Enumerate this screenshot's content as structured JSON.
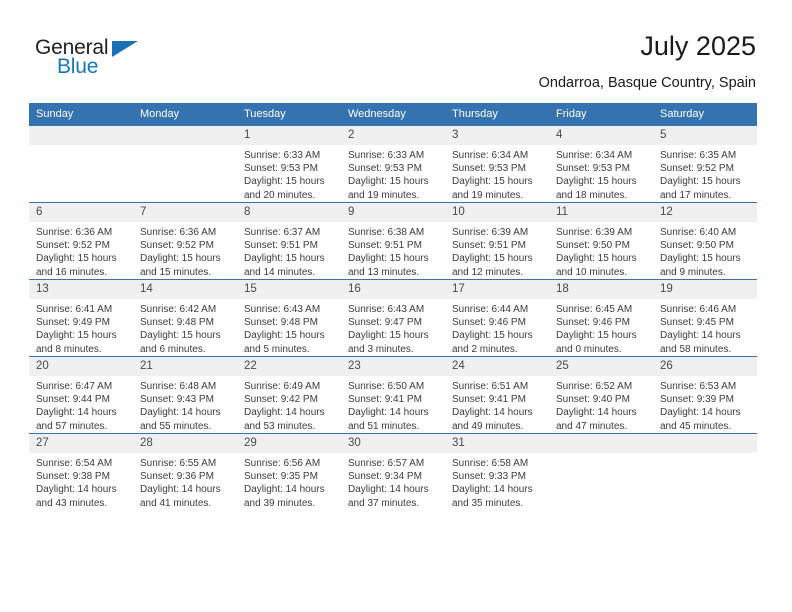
{
  "brand": {
    "name_top": "General",
    "name_bottom": "Blue",
    "accent_color": "#1b75bb",
    "header_color": "#3572b0"
  },
  "header": {
    "title": "July 2025",
    "subtitle": "Ondarroa, Basque Country, Spain"
  },
  "weekday_headers": [
    "Sunday",
    "Monday",
    "Tuesday",
    "Wednesday",
    "Thursday",
    "Friday",
    "Saturday"
  ],
  "labels": {
    "sunrise_prefix": "Sunrise:",
    "sunset_prefix": "Sunset:",
    "daylight_prefix": "Daylight:"
  },
  "weeks": [
    [
      {
        "day": "",
        "empty": true
      },
      {
        "day": "",
        "empty": true
      },
      {
        "day": "1",
        "sunrise": "Sunrise: 6:33 AM",
        "sunset": "Sunset: 9:53 PM",
        "daylight1": "Daylight: 15 hours",
        "daylight2": "and 20 minutes."
      },
      {
        "day": "2",
        "sunrise": "Sunrise: 6:33 AM",
        "sunset": "Sunset: 9:53 PM",
        "daylight1": "Daylight: 15 hours",
        "daylight2": "and 19 minutes."
      },
      {
        "day": "3",
        "sunrise": "Sunrise: 6:34 AM",
        "sunset": "Sunset: 9:53 PM",
        "daylight1": "Daylight: 15 hours",
        "daylight2": "and 19 minutes."
      },
      {
        "day": "4",
        "sunrise": "Sunrise: 6:34 AM",
        "sunset": "Sunset: 9:53 PM",
        "daylight1": "Daylight: 15 hours",
        "daylight2": "and 18 minutes."
      },
      {
        "day": "5",
        "sunrise": "Sunrise: 6:35 AM",
        "sunset": "Sunset: 9:52 PM",
        "daylight1": "Daylight: 15 hours",
        "daylight2": "and 17 minutes."
      }
    ],
    [
      {
        "day": "6",
        "sunrise": "Sunrise: 6:36 AM",
        "sunset": "Sunset: 9:52 PM",
        "daylight1": "Daylight: 15 hours",
        "daylight2": "and 16 minutes."
      },
      {
        "day": "7",
        "sunrise": "Sunrise: 6:36 AM",
        "sunset": "Sunset: 9:52 PM",
        "daylight1": "Daylight: 15 hours",
        "daylight2": "and 15 minutes."
      },
      {
        "day": "8",
        "sunrise": "Sunrise: 6:37 AM",
        "sunset": "Sunset: 9:51 PM",
        "daylight1": "Daylight: 15 hours",
        "daylight2": "and 14 minutes."
      },
      {
        "day": "9",
        "sunrise": "Sunrise: 6:38 AM",
        "sunset": "Sunset: 9:51 PM",
        "daylight1": "Daylight: 15 hours",
        "daylight2": "and 13 minutes."
      },
      {
        "day": "10",
        "sunrise": "Sunrise: 6:39 AM",
        "sunset": "Sunset: 9:51 PM",
        "daylight1": "Daylight: 15 hours",
        "daylight2": "and 12 minutes."
      },
      {
        "day": "11",
        "sunrise": "Sunrise: 6:39 AM",
        "sunset": "Sunset: 9:50 PM",
        "daylight1": "Daylight: 15 hours",
        "daylight2": "and 10 minutes."
      },
      {
        "day": "12",
        "sunrise": "Sunrise: 6:40 AM",
        "sunset": "Sunset: 9:50 PM",
        "daylight1": "Daylight: 15 hours",
        "daylight2": "and 9 minutes."
      }
    ],
    [
      {
        "day": "13",
        "sunrise": "Sunrise: 6:41 AM",
        "sunset": "Sunset: 9:49 PM",
        "daylight1": "Daylight: 15 hours",
        "daylight2": "and 8 minutes."
      },
      {
        "day": "14",
        "sunrise": "Sunrise: 6:42 AM",
        "sunset": "Sunset: 9:48 PM",
        "daylight1": "Daylight: 15 hours",
        "daylight2": "and 6 minutes."
      },
      {
        "day": "15",
        "sunrise": "Sunrise: 6:43 AM",
        "sunset": "Sunset: 9:48 PM",
        "daylight1": "Daylight: 15 hours",
        "daylight2": "and 5 minutes."
      },
      {
        "day": "16",
        "sunrise": "Sunrise: 6:43 AM",
        "sunset": "Sunset: 9:47 PM",
        "daylight1": "Daylight: 15 hours",
        "daylight2": "and 3 minutes."
      },
      {
        "day": "17",
        "sunrise": "Sunrise: 6:44 AM",
        "sunset": "Sunset: 9:46 PM",
        "daylight1": "Daylight: 15 hours",
        "daylight2": "and 2 minutes."
      },
      {
        "day": "18",
        "sunrise": "Sunrise: 6:45 AM",
        "sunset": "Sunset: 9:46 PM",
        "daylight1": "Daylight: 15 hours",
        "daylight2": "and 0 minutes."
      },
      {
        "day": "19",
        "sunrise": "Sunrise: 6:46 AM",
        "sunset": "Sunset: 9:45 PM",
        "daylight1": "Daylight: 14 hours",
        "daylight2": "and 58 minutes."
      }
    ],
    [
      {
        "day": "20",
        "sunrise": "Sunrise: 6:47 AM",
        "sunset": "Sunset: 9:44 PM",
        "daylight1": "Daylight: 14 hours",
        "daylight2": "and 57 minutes."
      },
      {
        "day": "21",
        "sunrise": "Sunrise: 6:48 AM",
        "sunset": "Sunset: 9:43 PM",
        "daylight1": "Daylight: 14 hours",
        "daylight2": "and 55 minutes."
      },
      {
        "day": "22",
        "sunrise": "Sunrise: 6:49 AM",
        "sunset": "Sunset: 9:42 PM",
        "daylight1": "Daylight: 14 hours",
        "daylight2": "and 53 minutes."
      },
      {
        "day": "23",
        "sunrise": "Sunrise: 6:50 AM",
        "sunset": "Sunset: 9:41 PM",
        "daylight1": "Daylight: 14 hours",
        "daylight2": "and 51 minutes."
      },
      {
        "day": "24",
        "sunrise": "Sunrise: 6:51 AM",
        "sunset": "Sunset: 9:41 PM",
        "daylight1": "Daylight: 14 hours",
        "daylight2": "and 49 minutes."
      },
      {
        "day": "25",
        "sunrise": "Sunrise: 6:52 AM",
        "sunset": "Sunset: 9:40 PM",
        "daylight1": "Daylight: 14 hours",
        "daylight2": "and 47 minutes."
      },
      {
        "day": "26",
        "sunrise": "Sunrise: 6:53 AM",
        "sunset": "Sunset: 9:39 PM",
        "daylight1": "Daylight: 14 hours",
        "daylight2": "and 45 minutes."
      }
    ],
    [
      {
        "day": "27",
        "sunrise": "Sunrise: 6:54 AM",
        "sunset": "Sunset: 9:38 PM",
        "daylight1": "Daylight: 14 hours",
        "daylight2": "and 43 minutes."
      },
      {
        "day": "28",
        "sunrise": "Sunrise: 6:55 AM",
        "sunset": "Sunset: 9:36 PM",
        "daylight1": "Daylight: 14 hours",
        "daylight2": "and 41 minutes."
      },
      {
        "day": "29",
        "sunrise": "Sunrise: 6:56 AM",
        "sunset": "Sunset: 9:35 PM",
        "daylight1": "Daylight: 14 hours",
        "daylight2": "and 39 minutes."
      },
      {
        "day": "30",
        "sunrise": "Sunrise: 6:57 AM",
        "sunset": "Sunset: 9:34 PM",
        "daylight1": "Daylight: 14 hours",
        "daylight2": "and 37 minutes."
      },
      {
        "day": "31",
        "sunrise": "Sunrise: 6:58 AM",
        "sunset": "Sunset: 9:33 PM",
        "daylight1": "Daylight: 14 hours",
        "daylight2": "and 35 minutes."
      },
      {
        "day": "",
        "empty": true
      },
      {
        "day": "",
        "empty": true
      }
    ]
  ]
}
